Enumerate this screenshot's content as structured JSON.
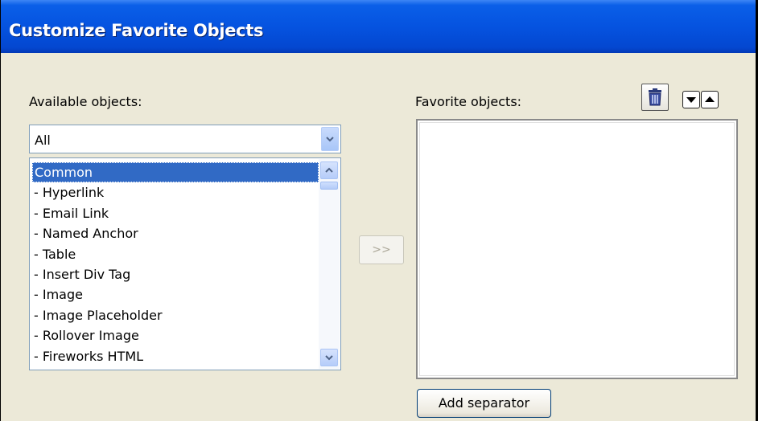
{
  "window": {
    "title": "Customize Favorite Objects"
  },
  "available": {
    "label": "Available objects:",
    "filter_value": "All",
    "items": [
      "Common",
      "- Hyperlink",
      "- Email Link",
      "- Named Anchor",
      "- Table",
      "- Insert Div Tag",
      "- Image",
      "- Image Placeholder",
      "- Rollover Image",
      "- Fireworks HTML"
    ],
    "selected_index": 0
  },
  "add_button": {
    "label": ">>"
  },
  "favorites": {
    "label": "Favorite objects:",
    "items": [],
    "add_separator_label": "Add separator"
  },
  "icons": {
    "delete": "trash-icon",
    "move_down": "arrow-down-icon",
    "move_up": "arrow-up-icon"
  }
}
